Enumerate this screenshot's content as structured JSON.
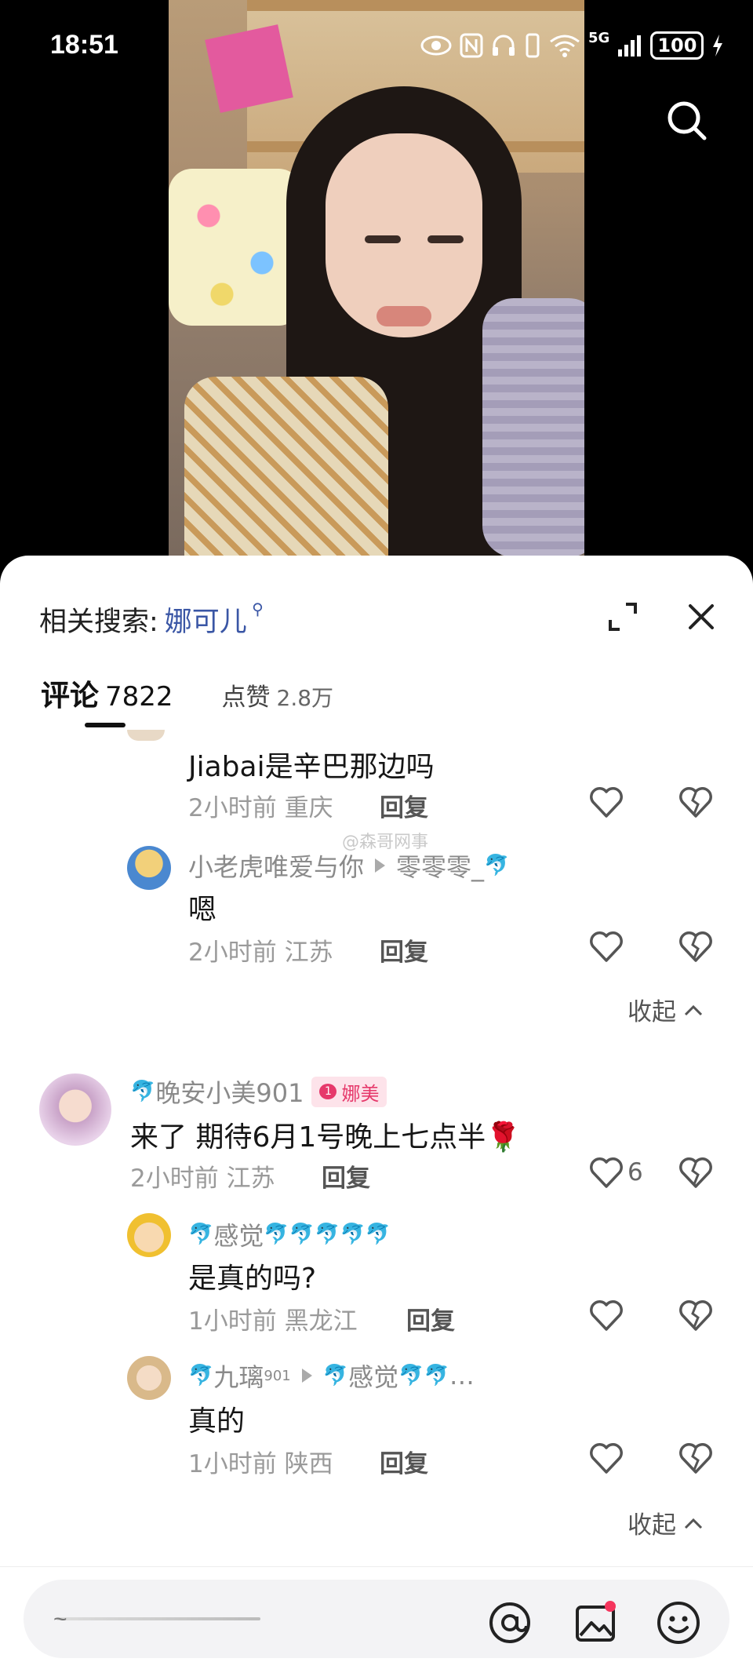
{
  "status_bar": {
    "time": "18:51",
    "network": "5G",
    "battery": "100"
  },
  "sheet": {
    "related_search_label": "相关搜索:",
    "related_search_keyword": "娜可儿"
  },
  "tabs": {
    "comments_label": "评论",
    "comments_count": "7822",
    "likes_label": "点赞",
    "likes_count": "2.8万"
  },
  "watermark": "@森哥网事",
  "comments": [
    {
      "text": "Jiabai是辛巴那边吗",
      "time": "2小时前",
      "location": "重庆",
      "reply_label": "回复"
    },
    {
      "author": "小老虎唯爱与你",
      "reply_to": "零零零_",
      "text": "嗯",
      "time": "2小时前",
      "location": "江苏",
      "reply_label": "回复"
    },
    {
      "author": "晚安小美901",
      "badge_level": "1",
      "badge_text": "娜美",
      "text": "来了 期待6月1号晚上七点半🌹",
      "time": "2小时前",
      "location": "江苏",
      "reply_label": "回复",
      "likes": "6"
    },
    {
      "author": "感觉",
      "text": "是真的吗?",
      "time": "1小时前",
      "location": "黑龙江",
      "reply_label": "回复"
    },
    {
      "author": "九璃",
      "author_sup": "901",
      "reply_to": "感觉",
      "text": "真的",
      "time": "1小时前",
      "location": "陕西",
      "reply_label": "回复"
    }
  ],
  "collapse_label": "收起",
  "input": {
    "placeholder": "~"
  },
  "colors": {
    "accent_link": "#3a56a5",
    "badge_pink": "#e6396b",
    "notification_dot": "#f5355d"
  }
}
